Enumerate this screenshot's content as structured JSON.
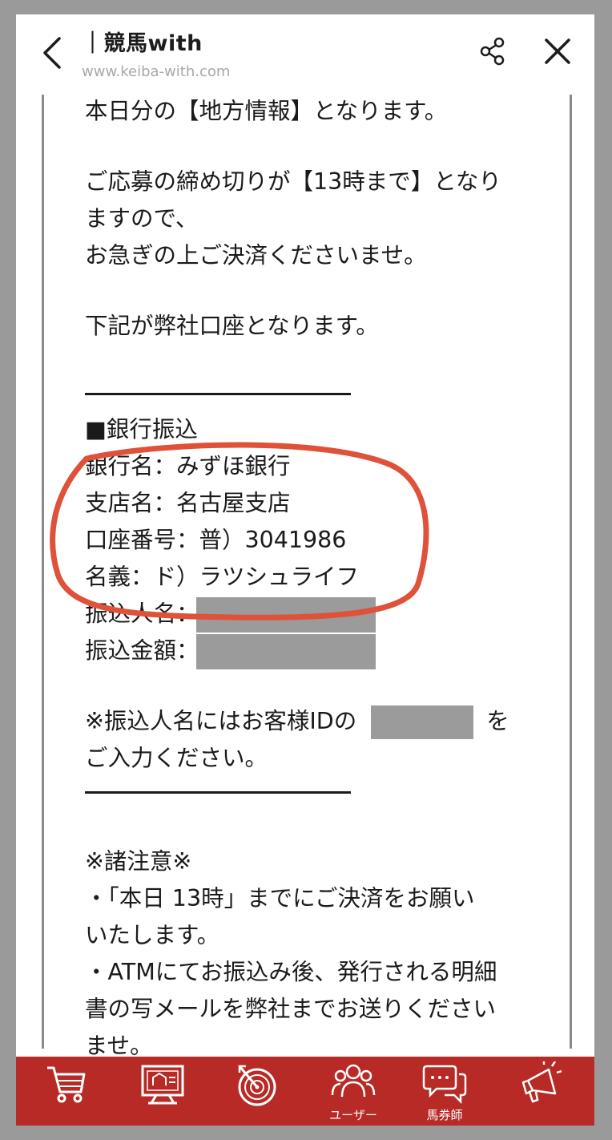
{
  "header": {
    "title": "｜競馬with",
    "url": "www.keiba-with.com"
  },
  "message": {
    "line1": "本日分の【地方情報】となります。",
    "line2": "ご応募の締め切りが【13時まで】となり",
    "line3": "ますので、",
    "line4": "お急ぎの上ご決済くださいませ。",
    "line5": "下記が弊社口座となります。",
    "bank_heading": "■銀行振込",
    "bank_name": "銀行名：みずほ銀行",
    "branch_name": "支店名：名古屋支店",
    "account_number": "口座番号：普）3041986",
    "account_holder": "名義：ド）ラツシュライフ",
    "payer_name_label": "振込人名：",
    "amount_label": "振込金額：",
    "note_id_before": "※振込人名にはお客様IDの",
    "note_id_after": "を",
    "note_id_line2": "ご入力ください。",
    "notes_heading": "※諸注意※",
    "note1_line1": "・「本日 13時」までにご決済をお願い",
    "note1_line2": "いたします。",
    "note2_line1": "・ATMにてお振込み後、発行される明細",
    "note2_line2": "書の写メールを弊社までお送りください",
    "note2_line3": "ませ。"
  },
  "tabs": [
    {
      "icon": "cart-icon",
      "label": ""
    },
    {
      "icon": "monitor-icon",
      "label": ""
    },
    {
      "icon": "target-icon",
      "label": ""
    },
    {
      "icon": "users-icon",
      "label": "ユーザー"
    },
    {
      "icon": "chat-icon",
      "label": "馬券師"
    },
    {
      "icon": "megaphone-icon",
      "label": ""
    }
  ],
  "colors": {
    "tabbar": "#b72a26",
    "annotation": "#e0513a",
    "mask": "#9b9b9b"
  }
}
